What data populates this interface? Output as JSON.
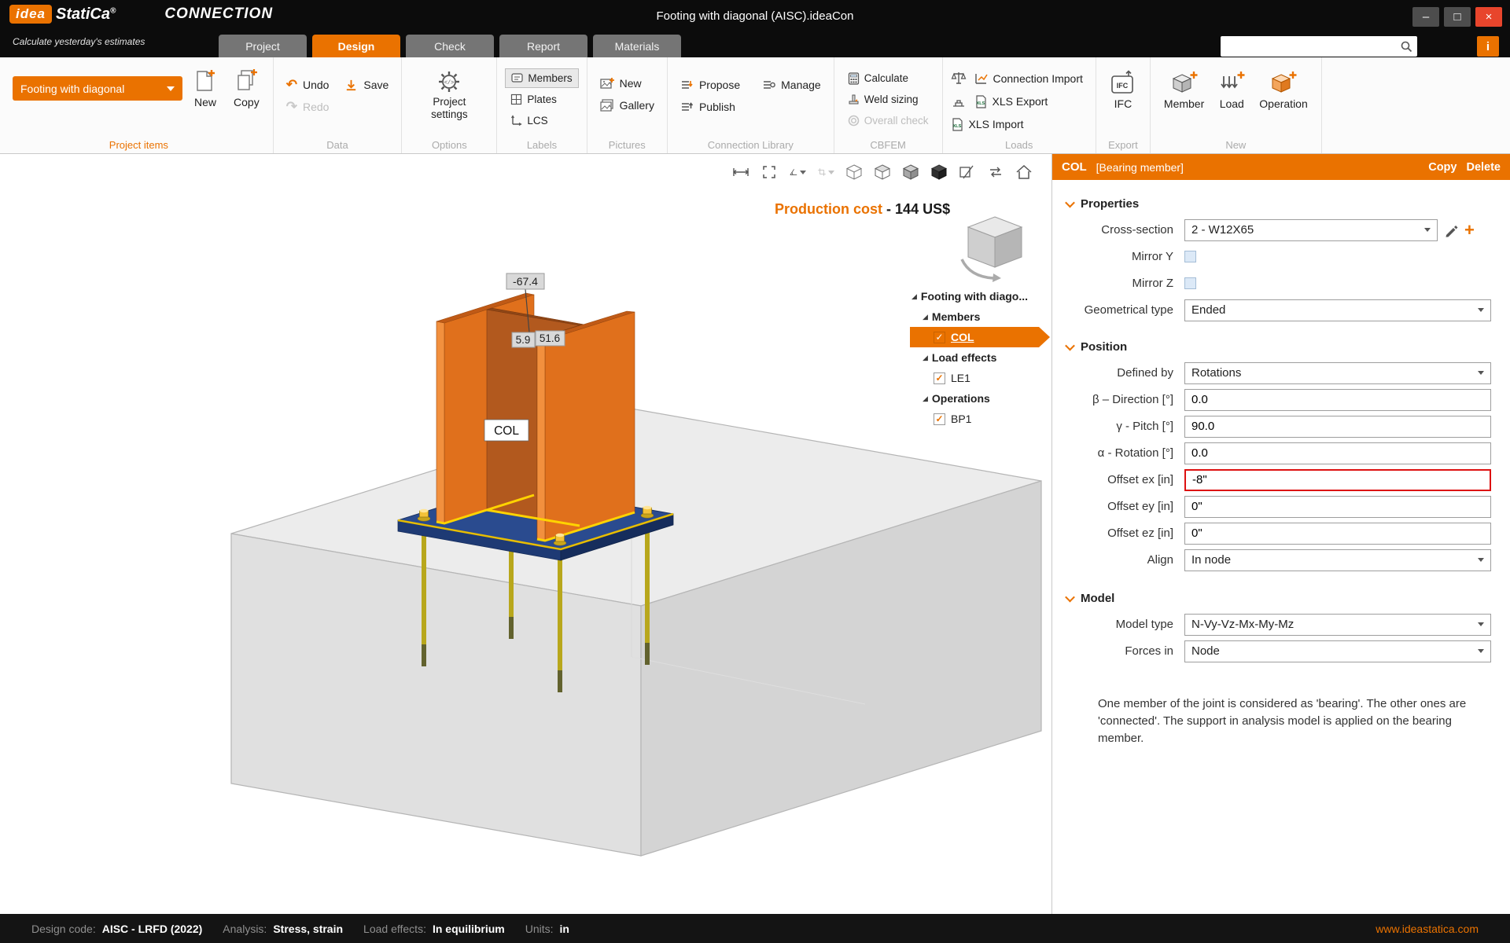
{
  "titlebar": {
    "logo_idea": "idea",
    "logo_statica": "StatiCa",
    "logo_reg": "®",
    "app": "CONNECTION",
    "tagline": "Calculate yesterday's estimates",
    "doc_title": "Footing with diagonal (AISC).ideaCon",
    "window": {
      "minimize": "–",
      "maximize": "□",
      "close": "×",
      "info": "i"
    }
  },
  "tabs": {
    "project": "Project",
    "design": "Design",
    "check": "Check",
    "report": "Report",
    "materials": "Materials"
  },
  "ribbon": {
    "project_items": {
      "group": "Project items",
      "selector": "Footing with diagonal",
      "new_label": "New",
      "copy_label": "Copy"
    },
    "data": {
      "group": "Data",
      "undo": "Undo",
      "save": "Save",
      "redo": "Redo",
      "undo_glyph": "↶",
      "redo_glyph": "↷"
    },
    "options": {
      "group": "Options",
      "settings": "Project settings"
    },
    "labels": {
      "group": "Labels",
      "members": "Members",
      "plates": "Plates",
      "lcs": "LCS"
    },
    "pictures": {
      "group": "Pictures",
      "new_label": "New",
      "gallery": "Gallery"
    },
    "library": {
      "group": "Connection Library",
      "propose": "Propose",
      "manage": "Manage",
      "publish": "Publish"
    },
    "cbfem": {
      "group": "CBFEM",
      "calculate": "Calculate",
      "weld_sizing": "Weld sizing",
      "overall_check": "Overall check"
    },
    "loads": {
      "group": "Loads",
      "connection_import": "Connection Import",
      "xls_export": "XLS Export",
      "xls_import": "XLS Import",
      "xls_badge": "XLS"
    },
    "export": {
      "group": "Export",
      "ifc_icon_text": "IFC",
      "ifc_label": "IFC"
    },
    "new_group": {
      "group": "New",
      "member": "Member",
      "load": "Load",
      "operation": "Operation"
    }
  },
  "viewport": {
    "cost_label": "Production cost",
    "cost_dash": "-",
    "cost_value": "144 US$",
    "dim1": "-67.4",
    "dim2": "5.9",
    "dim3": "51.6",
    "member_label": "COL"
  },
  "tree": {
    "expander": "◢",
    "check": "✓",
    "root": "Footing with diago...",
    "members": "Members",
    "col": "COL",
    "load_effects": "Load effects",
    "le1": "LE1",
    "operations": "Operations",
    "bp1": "BP1"
  },
  "properties": {
    "header_name": "COL",
    "header_type": "[Bearing member]",
    "copy": "Copy",
    "delete": "Delete",
    "sections": {
      "properties": "Properties",
      "position": "Position",
      "model": "Model"
    },
    "rows": {
      "cross_section": {
        "label": "Cross-section",
        "value": "2 - W12X65"
      },
      "mirror_y": {
        "label": "Mirror Y"
      },
      "mirror_z": {
        "label": "Mirror Z"
      },
      "geom_type": {
        "label": "Geometrical type",
        "value": "Ended"
      },
      "defined_by": {
        "label": "Defined by",
        "value": "Rotations"
      },
      "beta": {
        "label": "β – Direction [°]",
        "value": "0.0"
      },
      "gamma": {
        "label": "γ - Pitch [°]",
        "value": "90.0"
      },
      "alpha": {
        "label": "α - Rotation [°]",
        "value": "0.0"
      },
      "offset_ex": {
        "label": "Offset ex [in]",
        "value": "-8\""
      },
      "offset_ey": {
        "label": "Offset ey [in]",
        "value": "0\""
      },
      "offset_ez": {
        "label": "Offset ez [in]",
        "value": "0\""
      },
      "align": {
        "label": "Align",
        "value": "In node"
      },
      "model_type": {
        "label": "Model type",
        "value": "N-Vy-Vz-Mx-My-Mz"
      },
      "forces_in": {
        "label": "Forces in",
        "value": "Node"
      }
    },
    "note": "One member of the joint is considered as 'bearing'. The other ones are 'connected'. The support in analysis model is applied on the bearing member."
  },
  "statusbar": {
    "design_code_label": "Design code:",
    "design_code": "AISC - LRFD (2022)",
    "analysis_label": "Analysis:",
    "analysis": "Stress, strain",
    "load_label": "Load effects:",
    "load_value": "In equilibrium",
    "units_label": "Units:",
    "units": "in",
    "website": "www.ideastatica.com"
  },
  "colors": {
    "accent": "#ea7200",
    "alert": "#dd1111",
    "plate_blue": "#2a4b8f",
    "column_orange": "#e0701c"
  }
}
